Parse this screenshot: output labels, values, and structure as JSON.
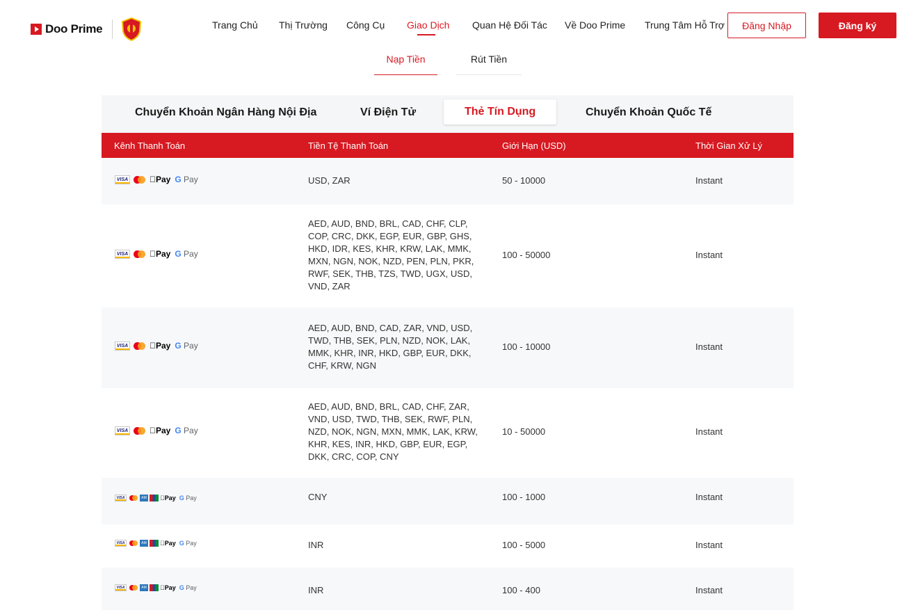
{
  "brand": {
    "name": "Doo Prime"
  },
  "nav": {
    "items": [
      "Trang Chủ",
      "Thị Trường",
      "Công Cụ",
      "Giao Dịch",
      "Quan Hệ Đối Tác",
      "Về Doo Prime",
      "Trung Tâm Hỗ Trợ"
    ],
    "active": "Giao Dịch",
    "login_label": "Đăng Nhập",
    "register_label": "Đăng ký"
  },
  "subtabs": {
    "deposit": "Nạp Tiền",
    "withdraw": "Rút Tiền",
    "active": "Nạp Tiền"
  },
  "method_tabs": {
    "items": [
      "Chuyển Khoản Ngân Hàng Nội Địa",
      "Ví Điện Tử",
      "Thẻ Tín Dụng",
      "Chuyển Khoản Quốc Tế"
    ],
    "active": "Thẻ Tín Dụng"
  },
  "table": {
    "headers": [
      "Kênh Thanh Toán",
      "Tiền Tệ Thanh Toán",
      "Giới Hạn (USD)",
      "Thời Gian Xử Lý"
    ],
    "rows": [
      {
        "channels": [
          "visa",
          "mastercard",
          "apple-pay",
          "google-pay"
        ],
        "currencies": "USD, ZAR",
        "limit": "50 - 10000",
        "time": "Instant"
      },
      {
        "channels": [
          "visa",
          "mastercard",
          "apple-pay",
          "google-pay"
        ],
        "currencies": "AED, AUD, BND, BRL, CAD, CHF, CLP, COP, CRC, DKK, EGP, EUR, GBP, GHS, HKD, IDR, KES, KHR, KRW, LAK, MMK, MXN, NGN, NOK, NZD, PEN, PLN, PKR, RWF, SEK, THB, TZS, TWD, UGX, USD, VND, ZAR",
        "limit": "100 - 50000",
        "time": "Instant"
      },
      {
        "channels": [
          "visa",
          "mastercard",
          "apple-pay",
          "google-pay"
        ],
        "currencies": "AED, AUD, BND, CAD, ZAR, VND, USD, TWD, THB, SEK, PLN, NZD, NOK, LAK, MMK, KHR, INR, HKD, GBP, EUR, DKK, CHF, KRW, NGN",
        "limit": "100 - 10000",
        "time": "Instant"
      },
      {
        "channels": [
          "visa",
          "mastercard",
          "apple-pay",
          "google-pay"
        ],
        "currencies": "AED, AUD, BND, BRL, CAD, CHF, ZAR, VND, USD, TWD, THB, SEK, RWF, PLN, NZD, NOK, NGN, MXN, MMK, LAK, KRW, KHR, KES, INR, HKD, GBP, EUR, EGP, DKK, CRC, COP, CNY",
        "limit": "10 - 50000",
        "time": "Instant"
      },
      {
        "channels": [
          "visa",
          "mastercard",
          "amex",
          "unionpay",
          "apple-pay",
          "google-pay"
        ],
        "currencies": "CNY",
        "limit": "100 - 1000",
        "time": "Instant"
      },
      {
        "channels": [
          "visa",
          "mastercard",
          "amex",
          "unionpay",
          "apple-pay",
          "google-pay"
        ],
        "currencies": "INR",
        "limit": "100 - 5000",
        "time": "Instant"
      },
      {
        "channels": [
          "visa",
          "mastercard",
          "amex",
          "unionpay",
          "apple-pay",
          "google-pay"
        ],
        "currencies": "INR",
        "limit": "100 - 400",
        "time": "Instant"
      }
    ]
  },
  "icon_labels": {
    "visa": "VISA",
    "apple_pay": "Pay",
    "google_pay": "Pay",
    "google_g": "G",
    "amex": "AM"
  },
  "colors": {
    "brand_red": "#d71921",
    "row_alt": "#f7f8f9"
  }
}
